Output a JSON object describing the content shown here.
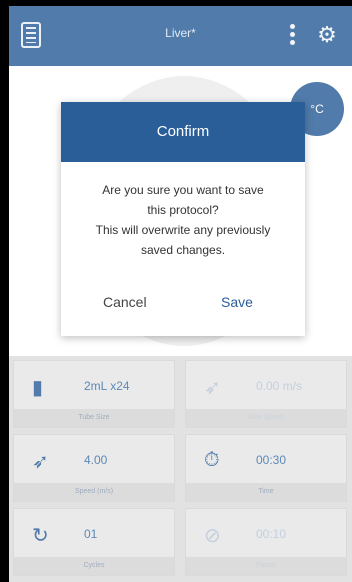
{
  "appbar": {
    "title": "Liver*"
  },
  "temperature": "°C",
  "dialog": {
    "title": "Confirm",
    "message_lines": [
      "Are you sure you want to save",
      "this protocol?",
      "This will overwrite any previously",
      "saved changes."
    ],
    "cancel_label": "Cancel",
    "save_label": "Save"
  },
  "tiles": [
    {
      "value": "2mL x24",
      "label": "Tube Size",
      "icon": "tube-icon",
      "dim": false
    },
    {
      "value": "0.00 m/s",
      "label": "Max Speed",
      "icon": "speed-icon",
      "dim": true
    },
    {
      "value": "4.00",
      "label": "Speed (m/s)",
      "icon": "speed-icon",
      "dim": false
    },
    {
      "value": "00:30",
      "label": "Time",
      "icon": "timer-icon",
      "dim": false
    },
    {
      "value": "01",
      "label": "Cycles",
      "icon": "cycle-icon",
      "dim": false
    },
    {
      "value": "00:10",
      "label": "Pause",
      "icon": "pause-timer-icon",
      "dim": true
    }
  ]
}
